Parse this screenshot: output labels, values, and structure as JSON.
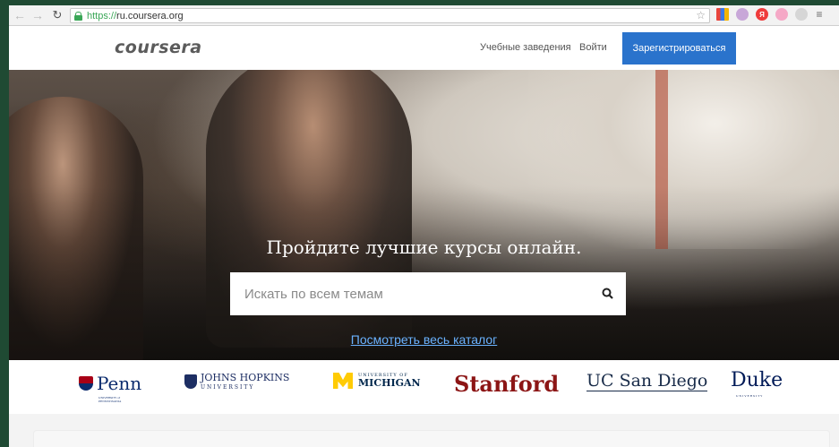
{
  "browser": {
    "url_scheme": "https://",
    "url_host": "ru.coursera.org",
    "icons": [
      "back-arrow-icon",
      "forward-arrow-icon",
      "reload-icon",
      "lock-icon",
      "star-icon",
      "extension-icons",
      "menu-icon"
    ]
  },
  "header": {
    "logo": "coursera",
    "nav": {
      "institutions": "Учебные заведения",
      "login": "Войти",
      "signup": "Зарегистрироваться"
    }
  },
  "hero": {
    "tagline": "Пройдите лучшие курсы онлайн.",
    "search_placeholder": "Искать по всем темам",
    "catalog_link": "Посмотреть весь каталог"
  },
  "partners": {
    "penn": "Penn",
    "penn_sub": "UNIVERSITY of PENNSYLVANIA",
    "jhu": "JOHNS HOPKINS",
    "jhu_sub": "UNIVERSITY",
    "umich_sub": "UNIVERSITY OF",
    "umich": "MICHIGAN",
    "stanford": "Stanford",
    "ucsd": "UC San Diego",
    "duke": "Duke",
    "duke_sub": "UNIVERSITY"
  },
  "colors": {
    "brand_blue": "#2a73cc",
    "link_blue": "#6ab2ff",
    "stanford_red": "#8c1515"
  }
}
